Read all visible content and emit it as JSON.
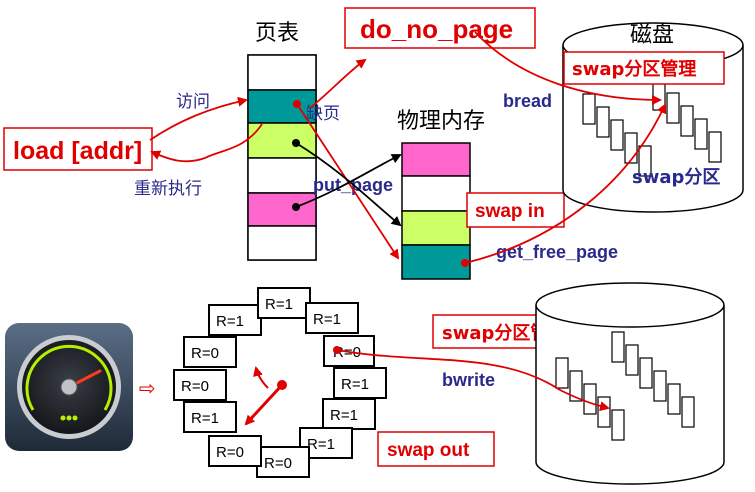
{
  "colors": {
    "red": "#e00000",
    "blue": "#2a2a8c",
    "magenta": "#ff66cc",
    "lime": "#ccff66",
    "teal": "#009999",
    "black": "#000000"
  },
  "top": {
    "page_table_label": "页表",
    "physical_memory_label": "物理内存",
    "disk_label": "磁盘",
    "do_no_page": "do_no_page",
    "load_addr": "load [addr]",
    "access_label": "访问",
    "page_fault_label": "缺页",
    "re_execute_label": "重新执行",
    "bread_label": "bread",
    "put_page_label": "put_page",
    "swap_in_label": "swap in",
    "get_free_page_label": "get_free_page",
    "swap_mgmt_label": "swap分区管理",
    "swap_partition_label": "swap分区"
  },
  "bottom": {
    "clock_icon": "speedometer-icon",
    "arrow_glyph": "⇨",
    "swap_mgmt_label": "swap分区管理",
    "bwrite_label": "bwrite",
    "swap_out_label": "swap out",
    "clock_entries": [
      "R=1",
      "R=1",
      "R=1",
      "R=0",
      "R=1",
      "R=1",
      "R=1",
      "R=0",
      "R=0",
      "R=1",
      "R=0",
      "R=0"
    ]
  }
}
